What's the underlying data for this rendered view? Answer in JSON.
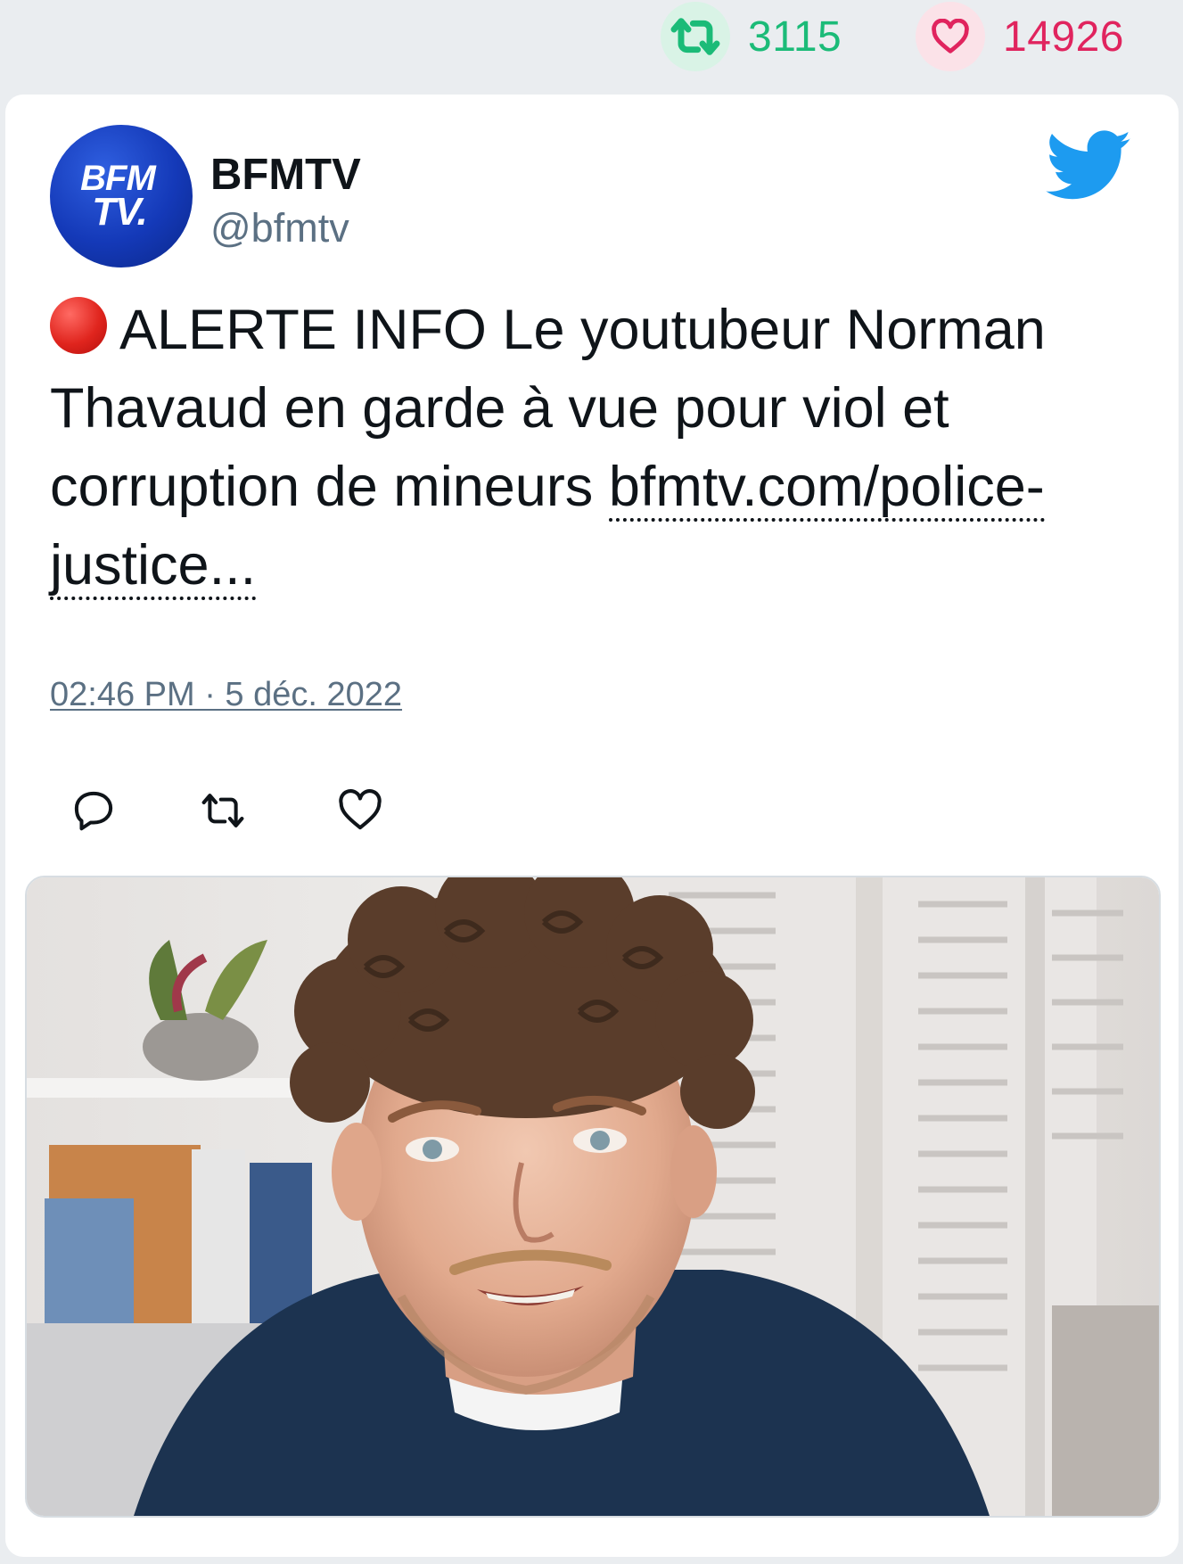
{
  "stats": {
    "retweets": "3115",
    "likes": "14926",
    "colors": {
      "retweet": "#1bbb78",
      "like": "#e0245e"
    }
  },
  "tweet": {
    "author": {
      "name": "BFMTV",
      "handle": "@bfmtv",
      "avatar_logo_text": [
        "BFM",
        "TV."
      ]
    },
    "platform_icon": "twitter-bird-icon",
    "text": {
      "emoji": "red-circle-emoji",
      "body": "ALERTE INFO Le youtubeur Norman Thavaud en garde à vue pour viol et corruption de mineurs ",
      "link": "bfmtv.com/police-justice..."
    },
    "timestamp": "02:46 PM · 5 déc. 2022",
    "actions": [
      {
        "name": "reply",
        "icon": "reply-icon"
      },
      {
        "name": "retweet",
        "icon": "retweet-icon"
      },
      {
        "name": "like",
        "icon": "heart-icon"
      }
    ],
    "media": {
      "kind": "photo",
      "icon": "photo-of-person"
    }
  }
}
